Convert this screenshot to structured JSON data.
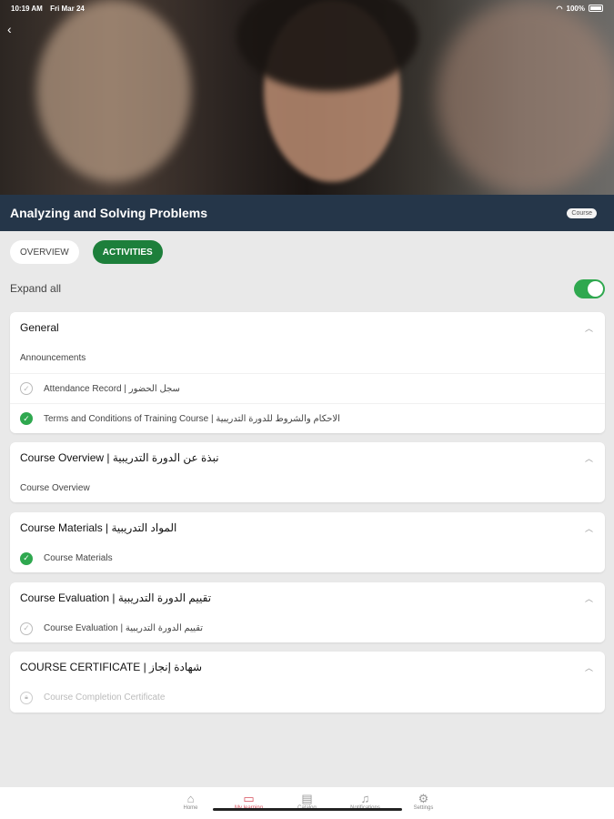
{
  "status_bar": {
    "time": "10:19 AM",
    "date": "Fri Mar 24",
    "battery": "100%"
  },
  "course": {
    "title": "Analyzing and Solving Problems",
    "type_badge": "Course"
  },
  "tabs": [
    {
      "label": "OVERVIEW",
      "active": false
    },
    {
      "label": "ACTIVITIES",
      "active": true
    }
  ],
  "expand_all": {
    "label": "Expand all",
    "on": true
  },
  "sections": [
    {
      "title": "General",
      "items": [
        {
          "label": "Announcements",
          "status": "none"
        },
        {
          "label": "Attendance Record | سجل الحضور",
          "status": "incomplete"
        },
        {
          "label": "Terms and Conditions of Training Course | الاحكام والشروط للدورة التدريبية",
          "status": "complete"
        }
      ]
    },
    {
      "title": "Course Overview | نبذة عن الدورة التدريبية",
      "items": [
        {
          "label": "Course Overview",
          "status": "none"
        }
      ]
    },
    {
      "title": "Course Materials | المواد التدريبية",
      "items": [
        {
          "label": "Course Materials",
          "status": "complete"
        }
      ]
    },
    {
      "title": "Course Evaluation | تقييم الدورة التدريبية",
      "items": [
        {
          "label": "Course Evaluation | تقييم الدورة التدريبية",
          "status": "incomplete"
        }
      ]
    },
    {
      "title": "COURSE CERTIFICATE | شهادة إنجاز",
      "items": [
        {
          "label": "Course Completion Certificate",
          "status": "locked"
        }
      ]
    }
  ],
  "bottom_nav": [
    {
      "label": "Home",
      "icon": "home-icon"
    },
    {
      "label": "My learning",
      "icon": "book-icon",
      "active": true
    },
    {
      "label": "Catalog",
      "icon": "catalog-icon"
    },
    {
      "label": "Notifications",
      "icon": "bell-icon"
    },
    {
      "label": "Settings",
      "icon": "gear-icon"
    }
  ],
  "colors": {
    "header": "#253649",
    "accent": "#1d7f3b",
    "complete": "#2fa84f",
    "nav_active": "#d64e5b"
  }
}
